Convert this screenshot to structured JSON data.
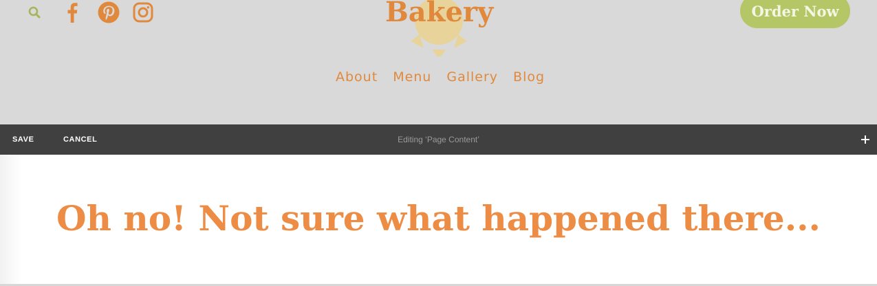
{
  "header": {
    "logo_text": "Bakery",
    "order_button_label": "Order Now",
    "social_icons": [
      "search-icon",
      "facebook-icon",
      "pinterest-icon",
      "instagram-icon"
    ],
    "nav": [
      "About",
      "Menu",
      "Gallery",
      "Blog"
    ]
  },
  "toolbar": {
    "save_label": "SAVE",
    "cancel_label": "CANCEL",
    "editing_label": "Editing ‘Page Content’",
    "add_icon": "plus-icon"
  },
  "content": {
    "headline": "Oh no!  Not sure what happened there..."
  },
  "colors": {
    "header_bg": "#d9d9d9",
    "toolbar_bg": "#404040",
    "accent_orange": "#e0893d",
    "button_green": "#b5c667",
    "icon_green": "#a6b45a",
    "logo_sun": "#e8d49a"
  }
}
